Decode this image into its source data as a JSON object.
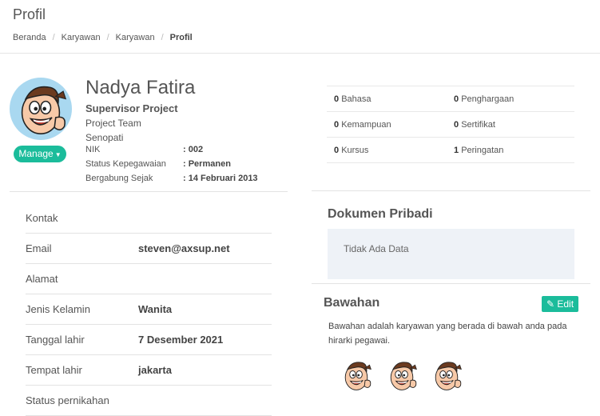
{
  "header": {
    "title": "Profil",
    "breadcrumb": [
      "Beranda",
      "Karyawan",
      "Karyawan",
      "Profil"
    ]
  },
  "profile": {
    "name": "Nadya Fatira",
    "job": "Supervisor Project",
    "team": "Project Team",
    "location": "Senopati",
    "manage_label": "Manage",
    "fields": [
      {
        "label": "NIK",
        "value": ": 002"
      },
      {
        "label": "Status Kepegawaian",
        "value": ": Permanen"
      },
      {
        "label": "Bergabung Sejak",
        "value": ": 14 Februari 2013"
      }
    ]
  },
  "stats": [
    {
      "left_count": "0",
      "left_label": "Bahasa",
      "right_count": "0",
      "right_label": "Penghargaan"
    },
    {
      "left_count": "0",
      "left_label": "Kemampuan",
      "right_count": "0",
      "right_label": "Sertifikat"
    },
    {
      "left_count": "0",
      "left_label": "Kursus",
      "right_count": "1",
      "right_label": "Peringatan"
    }
  ],
  "contact": {
    "rows": [
      {
        "label": "Kontak",
        "value": ""
      },
      {
        "label": "Email",
        "value": "steven@axsup.net"
      },
      {
        "label": "Alamat",
        "value": ""
      },
      {
        "label": "Jenis Kelamin",
        "value": "Wanita"
      },
      {
        "label": "Tanggal lahir",
        "value": "7 Desember 2021"
      },
      {
        "label": "Tempat lahir",
        "value": "jakarta"
      },
      {
        "label": "Status pernikahan",
        "value": ""
      }
    ]
  },
  "documents": {
    "title": "Dokumen Pribadi",
    "empty_text": "Tidak Ada Data"
  },
  "subordinates": {
    "title": "Bawahan",
    "edit_label": "Edit",
    "description": "Bawahan adalah karyawan yang berada di bawah anda pada hirarki pegawai."
  },
  "colors": {
    "accent": "#1bbc9b",
    "avatar_bg": "#a9d8f0",
    "empty_box_bg": "#eef2f7"
  }
}
